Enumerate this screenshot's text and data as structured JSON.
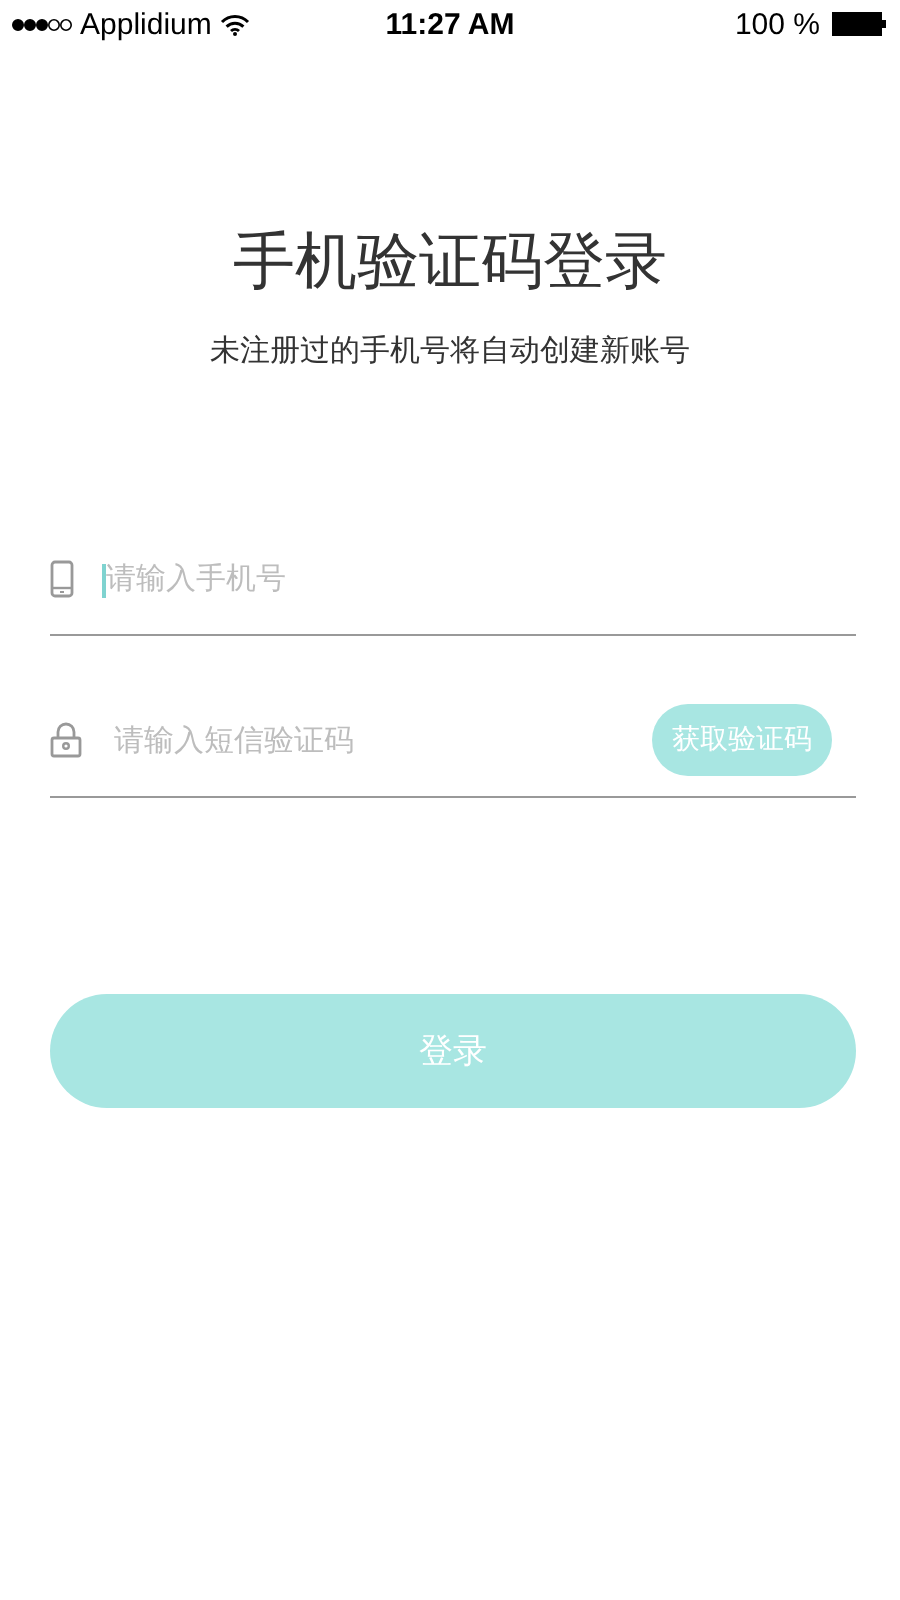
{
  "status_bar": {
    "carrier": "Applidium",
    "time": "11:27 AM",
    "battery": "100 %"
  },
  "title": "手机验证码登录",
  "subtitle": "未注册过的手机号将自动创建新账号",
  "fields": [
    {
      "kind": "phone",
      "placeholder": "请输入手机号",
      "focused": true
    },
    {
      "kind": "code",
      "placeholder": "请输入短信验证码",
      "focused": false,
      "action": "获取验证码"
    }
  ],
  "login_button": "登录"
}
